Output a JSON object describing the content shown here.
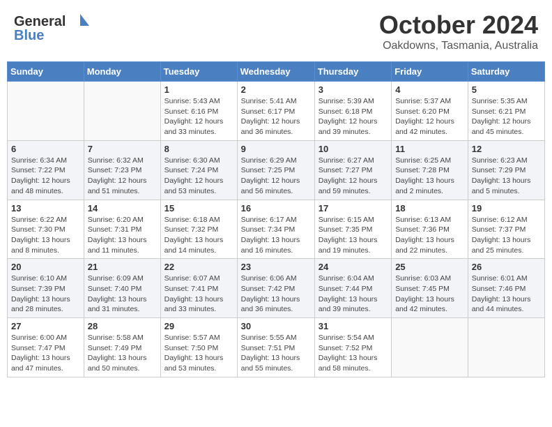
{
  "header": {
    "logo_line1": "General",
    "logo_line2": "Blue",
    "main_title": "October 2024",
    "subtitle": "Oakdowns, Tasmania, Australia"
  },
  "days_of_week": [
    "Sunday",
    "Monday",
    "Tuesday",
    "Wednesday",
    "Thursday",
    "Friday",
    "Saturday"
  ],
  "weeks": [
    [
      {
        "day": "",
        "info": ""
      },
      {
        "day": "",
        "info": ""
      },
      {
        "day": "1",
        "info": "Sunrise: 5:43 AM\nSunset: 6:16 PM\nDaylight: 12 hours\nand 33 minutes."
      },
      {
        "day": "2",
        "info": "Sunrise: 5:41 AM\nSunset: 6:17 PM\nDaylight: 12 hours\nand 36 minutes."
      },
      {
        "day": "3",
        "info": "Sunrise: 5:39 AM\nSunset: 6:18 PM\nDaylight: 12 hours\nand 39 minutes."
      },
      {
        "day": "4",
        "info": "Sunrise: 5:37 AM\nSunset: 6:20 PM\nDaylight: 12 hours\nand 42 minutes."
      },
      {
        "day": "5",
        "info": "Sunrise: 5:35 AM\nSunset: 6:21 PM\nDaylight: 12 hours\nand 45 minutes."
      }
    ],
    [
      {
        "day": "6",
        "info": "Sunrise: 6:34 AM\nSunset: 7:22 PM\nDaylight: 12 hours\nand 48 minutes."
      },
      {
        "day": "7",
        "info": "Sunrise: 6:32 AM\nSunset: 7:23 PM\nDaylight: 12 hours\nand 51 minutes."
      },
      {
        "day": "8",
        "info": "Sunrise: 6:30 AM\nSunset: 7:24 PM\nDaylight: 12 hours\nand 53 minutes."
      },
      {
        "day": "9",
        "info": "Sunrise: 6:29 AM\nSunset: 7:25 PM\nDaylight: 12 hours\nand 56 minutes."
      },
      {
        "day": "10",
        "info": "Sunrise: 6:27 AM\nSunset: 7:27 PM\nDaylight: 12 hours\nand 59 minutes."
      },
      {
        "day": "11",
        "info": "Sunrise: 6:25 AM\nSunset: 7:28 PM\nDaylight: 13 hours\nand 2 minutes."
      },
      {
        "day": "12",
        "info": "Sunrise: 6:23 AM\nSunset: 7:29 PM\nDaylight: 13 hours\nand 5 minutes."
      }
    ],
    [
      {
        "day": "13",
        "info": "Sunrise: 6:22 AM\nSunset: 7:30 PM\nDaylight: 13 hours\nand 8 minutes."
      },
      {
        "day": "14",
        "info": "Sunrise: 6:20 AM\nSunset: 7:31 PM\nDaylight: 13 hours\nand 11 minutes."
      },
      {
        "day": "15",
        "info": "Sunrise: 6:18 AM\nSunset: 7:32 PM\nDaylight: 13 hours\nand 14 minutes."
      },
      {
        "day": "16",
        "info": "Sunrise: 6:17 AM\nSunset: 7:34 PM\nDaylight: 13 hours\nand 16 minutes."
      },
      {
        "day": "17",
        "info": "Sunrise: 6:15 AM\nSunset: 7:35 PM\nDaylight: 13 hours\nand 19 minutes."
      },
      {
        "day": "18",
        "info": "Sunrise: 6:13 AM\nSunset: 7:36 PM\nDaylight: 13 hours\nand 22 minutes."
      },
      {
        "day": "19",
        "info": "Sunrise: 6:12 AM\nSunset: 7:37 PM\nDaylight: 13 hours\nand 25 minutes."
      }
    ],
    [
      {
        "day": "20",
        "info": "Sunrise: 6:10 AM\nSunset: 7:39 PM\nDaylight: 13 hours\nand 28 minutes."
      },
      {
        "day": "21",
        "info": "Sunrise: 6:09 AM\nSunset: 7:40 PM\nDaylight: 13 hours\nand 31 minutes."
      },
      {
        "day": "22",
        "info": "Sunrise: 6:07 AM\nSunset: 7:41 PM\nDaylight: 13 hours\nand 33 minutes."
      },
      {
        "day": "23",
        "info": "Sunrise: 6:06 AM\nSunset: 7:42 PM\nDaylight: 13 hours\nand 36 minutes."
      },
      {
        "day": "24",
        "info": "Sunrise: 6:04 AM\nSunset: 7:44 PM\nDaylight: 13 hours\nand 39 minutes."
      },
      {
        "day": "25",
        "info": "Sunrise: 6:03 AM\nSunset: 7:45 PM\nDaylight: 13 hours\nand 42 minutes."
      },
      {
        "day": "26",
        "info": "Sunrise: 6:01 AM\nSunset: 7:46 PM\nDaylight: 13 hours\nand 44 minutes."
      }
    ],
    [
      {
        "day": "27",
        "info": "Sunrise: 6:00 AM\nSunset: 7:47 PM\nDaylight: 13 hours\nand 47 minutes."
      },
      {
        "day": "28",
        "info": "Sunrise: 5:58 AM\nSunset: 7:49 PM\nDaylight: 13 hours\nand 50 minutes."
      },
      {
        "day": "29",
        "info": "Sunrise: 5:57 AM\nSunset: 7:50 PM\nDaylight: 13 hours\nand 53 minutes."
      },
      {
        "day": "30",
        "info": "Sunrise: 5:55 AM\nSunset: 7:51 PM\nDaylight: 13 hours\nand 55 minutes."
      },
      {
        "day": "31",
        "info": "Sunrise: 5:54 AM\nSunset: 7:52 PM\nDaylight: 13 hours\nand 58 minutes."
      },
      {
        "day": "",
        "info": ""
      },
      {
        "day": "",
        "info": ""
      }
    ]
  ]
}
